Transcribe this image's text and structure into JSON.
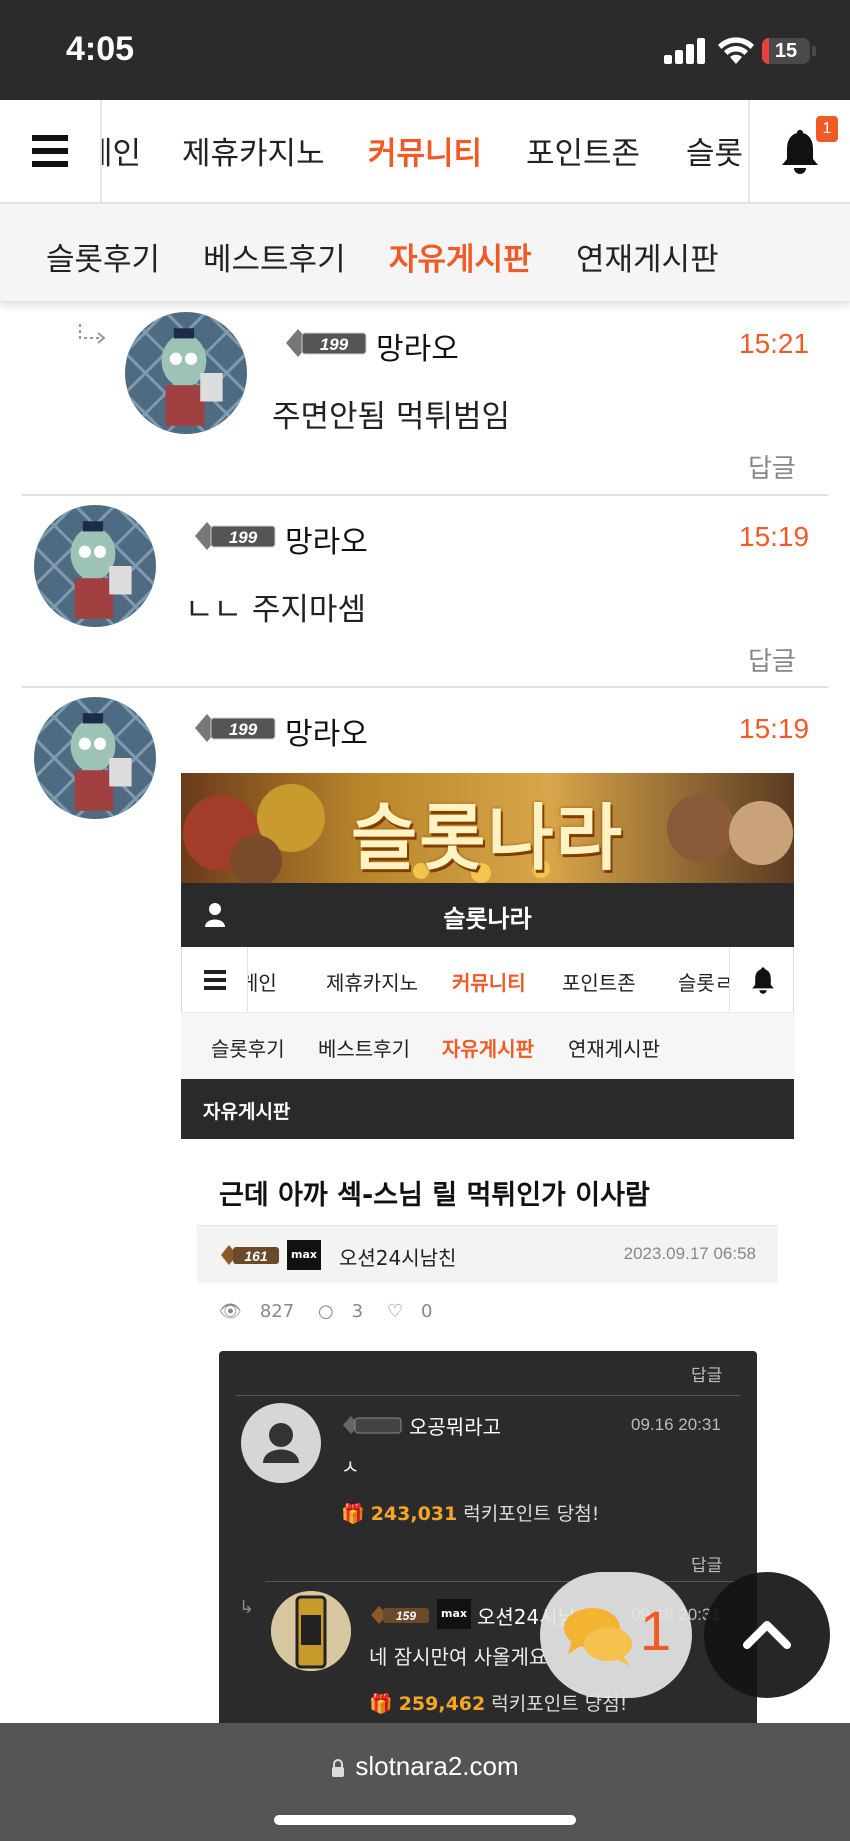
{
  "status_bar": {
    "time": "4:05",
    "battery": "15",
    "battery_level": 0.15
  },
  "top_nav": {
    "items": [
      "게인",
      "제휴카지노",
      "커뮤니티",
      "포인트존",
      "슬롯"
    ],
    "active": "커뮤니티",
    "notification_count": "1"
  },
  "sub_nav": {
    "items": [
      "슬롯후기",
      "베스트후기",
      "자유게시판",
      "연재게시판"
    ],
    "active": "자유게시판"
  },
  "comments": [
    {
      "level": "199",
      "nickname": "망라오",
      "time": "15:21",
      "text": "주면안됨 먹튀범임",
      "reply": "답글",
      "is_reply": true
    },
    {
      "level": "199",
      "nickname": "망라오",
      "time": "15:19",
      "text": "ㄴㄴ 주지마셈",
      "reply": "답글",
      "is_reply": false
    },
    {
      "level": "199",
      "nickname": "망라오",
      "time": "15:19",
      "text": "",
      "reply": "",
      "is_reply": false
    }
  ],
  "embedded_image": {
    "banner_title": "슬롯나라",
    "header_title": "슬롯나라",
    "nav_items": [
      "게인",
      "제휴카지노",
      "커뮤니티",
      "포인트존",
      "슬롯ㄹ"
    ],
    "nav_active": "커뮤니티",
    "sub_items": [
      "슬롯후기",
      "베스트후기",
      "자유게시판",
      "연재게시판"
    ],
    "sub_active": "자유게시판",
    "board_title": "자유게시판",
    "post_title": "근데 아까 섹-스님 릴 먹튀인가 이사람",
    "author_level": "161",
    "author_tag": "max",
    "author": "오션24시남친",
    "date": "2023.09.17 06:58",
    "views": "827",
    "comments_count": "3",
    "likes": "0",
    "dark_comments": [
      {
        "reply_label": "답글",
        "nickname": "오공뭐라고",
        "date": "09.16 20:31",
        "text": "ㅅ",
        "points": "243,031",
        "points_suffix": "럭키포인트 당첨!"
      },
      {
        "reply_label": "답글",
        "level": "159",
        "tag": "max",
        "nickname": "오션24시남친",
        "date": "09.16 20:31",
        "text": "네 잠시만여 사올게요",
        "points": "259,462",
        "points_suffix": "럭키포인트 당첨!"
      }
    ]
  },
  "float_chat": {
    "count": "1"
  },
  "browser": {
    "url": "slotnara2.com"
  },
  "colors": {
    "accent": "#f05a24",
    "dark": "#2a2a2a",
    "status_bg": "#2b2b2b",
    "browser_bg": "#555555"
  }
}
